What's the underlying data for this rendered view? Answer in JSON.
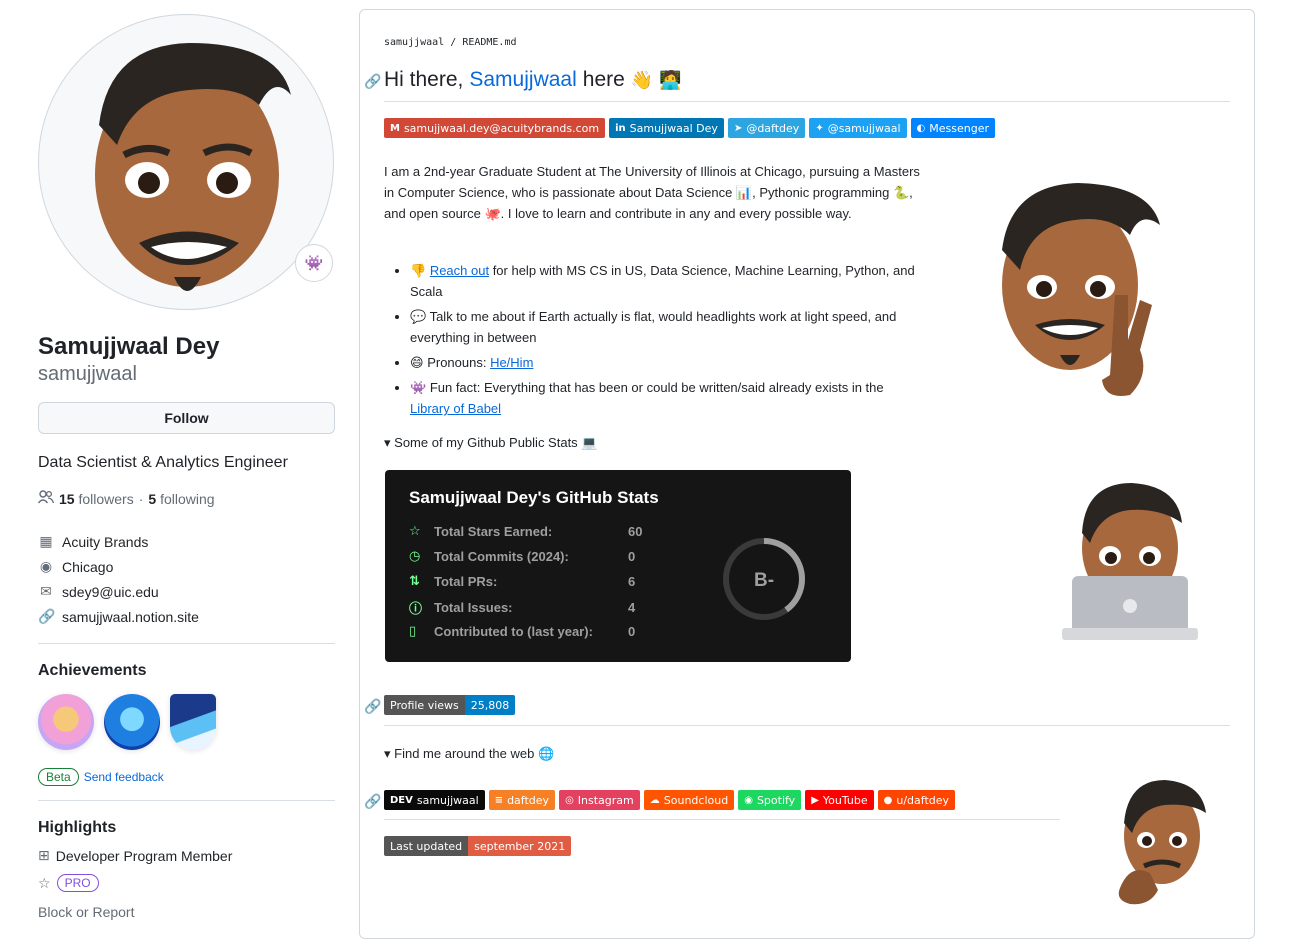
{
  "sidebar": {
    "name": "Samujjwaal Dey",
    "username": "samujjwaal",
    "follow_label": "Follow",
    "bio": "Data Scientist & Analytics Engineer",
    "followers_count": "15",
    "followers_label": "followers",
    "following_count": "5",
    "following_label": "following",
    "separator": "·",
    "company": "Acuity Brands",
    "location": "Chicago",
    "email": "sdey9@uic.edu",
    "website": "samujjwaal.notion.site",
    "achievements_title": "Achievements",
    "beta_label": "Beta",
    "feedback_label": "Send feedback",
    "highlights_title": "Highlights",
    "developer_program": "Developer Program Member",
    "pro_label": "PRO",
    "block_report": "Block or Report"
  },
  "readme": {
    "crumb_user": "samujjwaal",
    "crumb_sep": "/",
    "crumb_file": "README.md",
    "heading_pre": "Hi there,",
    "heading_name": "Samujjwaal",
    "heading_post": "here",
    "contact_badges": [
      {
        "label": "samujjwaal.dey@acuitybrands.com",
        "icon": "M",
        "color": "#d14836"
      },
      {
        "label": "Samujjwaal Dey",
        "icon": "in",
        "color": "#0077b5"
      },
      {
        "label": "@daftdey",
        "icon": "➤",
        "color": "#2ca5e0"
      },
      {
        "label": "@samujjwaal",
        "icon": "✦",
        "color": "#1da1f2"
      },
      {
        "label": "Messenger",
        "icon": "◐",
        "color": "#0084ff"
      }
    ],
    "intro_1": "I am a 2nd-year Graduate Student at The University of Illinois at Chicago, pursuing a Masters in Computer Science, who is passionate about Data Science 📊, Pythonic programming 🐍, and open source 🐙. I love to learn and contribute in any and every possible way.",
    "bullets": {
      "b1_icon": "👎",
      "b1_link": "Reach out",
      "b1_text": " for help with MS CS in US, Data Science, Machine Learning, Python, and Scala",
      "b2_icon": "💬",
      "b2_text": "Talk to me about if Earth actually is flat, would headlights work at light speed, and everything in between",
      "b3_icon": "😄",
      "b3_text": "Pronouns: ",
      "b3_link": "He/Him",
      "b4_icon": "👾",
      "b4_text": "Fun fact: Everything that has been or could be written/said already exists in the ",
      "b4_link": "Library of Babel"
    },
    "stats_summary": "Some of my Github Public Stats",
    "stats": {
      "title": "Samujjwaal Dey's GitHub Stats",
      "rows": [
        {
          "icon": "☆",
          "label": "Total Stars Earned:",
          "value": "60"
        },
        {
          "icon": "◷",
          "label": "Total Commits (2024):",
          "value": "0"
        },
        {
          "icon": "⇅",
          "label": "Total PRs:",
          "value": "6"
        },
        {
          "icon": "ⓘ",
          "label": "Total Issues:",
          "value": "4"
        },
        {
          "icon": "▯",
          "label": "Contributed to (last year):",
          "value": "0"
        }
      ],
      "grade": "B-",
      "grade_progress": 0.4
    },
    "views_label": "Profile views",
    "views_value": "25,808",
    "find_summary": "Find me around the web",
    "social_badges": [
      {
        "label": "samujjwaal",
        "icon": "DEV",
        "color": "#0a0a0a"
      },
      {
        "label": "daftdey",
        "icon": "≡",
        "color": "#f58025"
      },
      {
        "label": "Instagram",
        "icon": "◎",
        "color": "#e4405f"
      },
      {
        "label": "Soundcloud",
        "icon": "☁",
        "color": "#ff5500"
      },
      {
        "label": "Spotify",
        "icon": "◉",
        "color": "#1ed760"
      },
      {
        "label": "YouTube",
        "icon": "▶",
        "color": "#ff0000"
      },
      {
        "label": "u/daftdey",
        "icon": "●",
        "color": "#ff4500"
      }
    ],
    "updated_label": "Last updated",
    "updated_value": "september 2021"
  }
}
